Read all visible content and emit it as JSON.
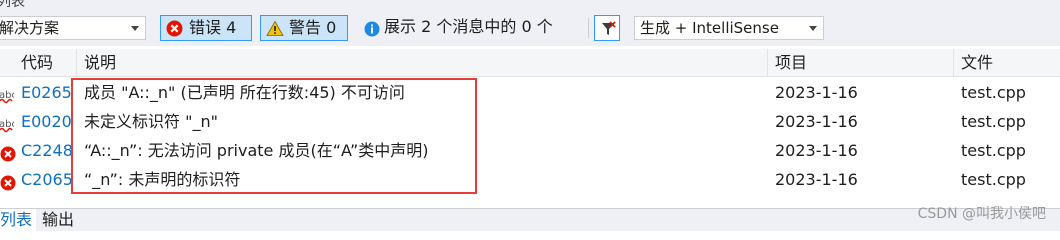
{
  "window": {
    "title": "列表"
  },
  "toolbar": {
    "scope_combo": "解决方案",
    "errors_label": "错误 4",
    "warnings_label": "警告 0",
    "messages_label": "展示 2 个消息中的 0 个",
    "build_combo": "生成 + IntelliSense"
  },
  "columns": {
    "code": "代码",
    "description": "说明",
    "project": "项目",
    "file": "文件"
  },
  "rows": [
    {
      "code": "E0265",
      "description": "成员 \"A::_n\" (已声明 所在行数:45) 不可访问",
      "project": "2023-1-16",
      "file": "test.cpp",
      "icon": "intellisense-error-icon"
    },
    {
      "code": "E0020",
      "description": "未定义标识符 \"_n\"",
      "project": "2023-1-16",
      "file": "test.cpp",
      "icon": "intellisense-error-icon"
    },
    {
      "code": "C2248",
      "description": "“A::_n”: 无法访问 private 成员(在“A”类中声明)",
      "project": "2023-1-16",
      "file": "test.cpp",
      "icon": "error-icon"
    },
    {
      "code": "C2065",
      "description": "“_n”: 未声明的标识符",
      "project": "2023-1-16",
      "file": "test.cpp",
      "icon": "error-icon"
    }
  ],
  "bottom_tabs": {
    "active": "列表",
    "output": "输出"
  },
  "watermark": "CSDN @叫我小侯吧",
  "colors": {
    "error": "#e51400",
    "warning": "#f4c20d",
    "info": "#1e88e5",
    "accent_border": "#3399ff",
    "highlight": "#e63c3c"
  }
}
